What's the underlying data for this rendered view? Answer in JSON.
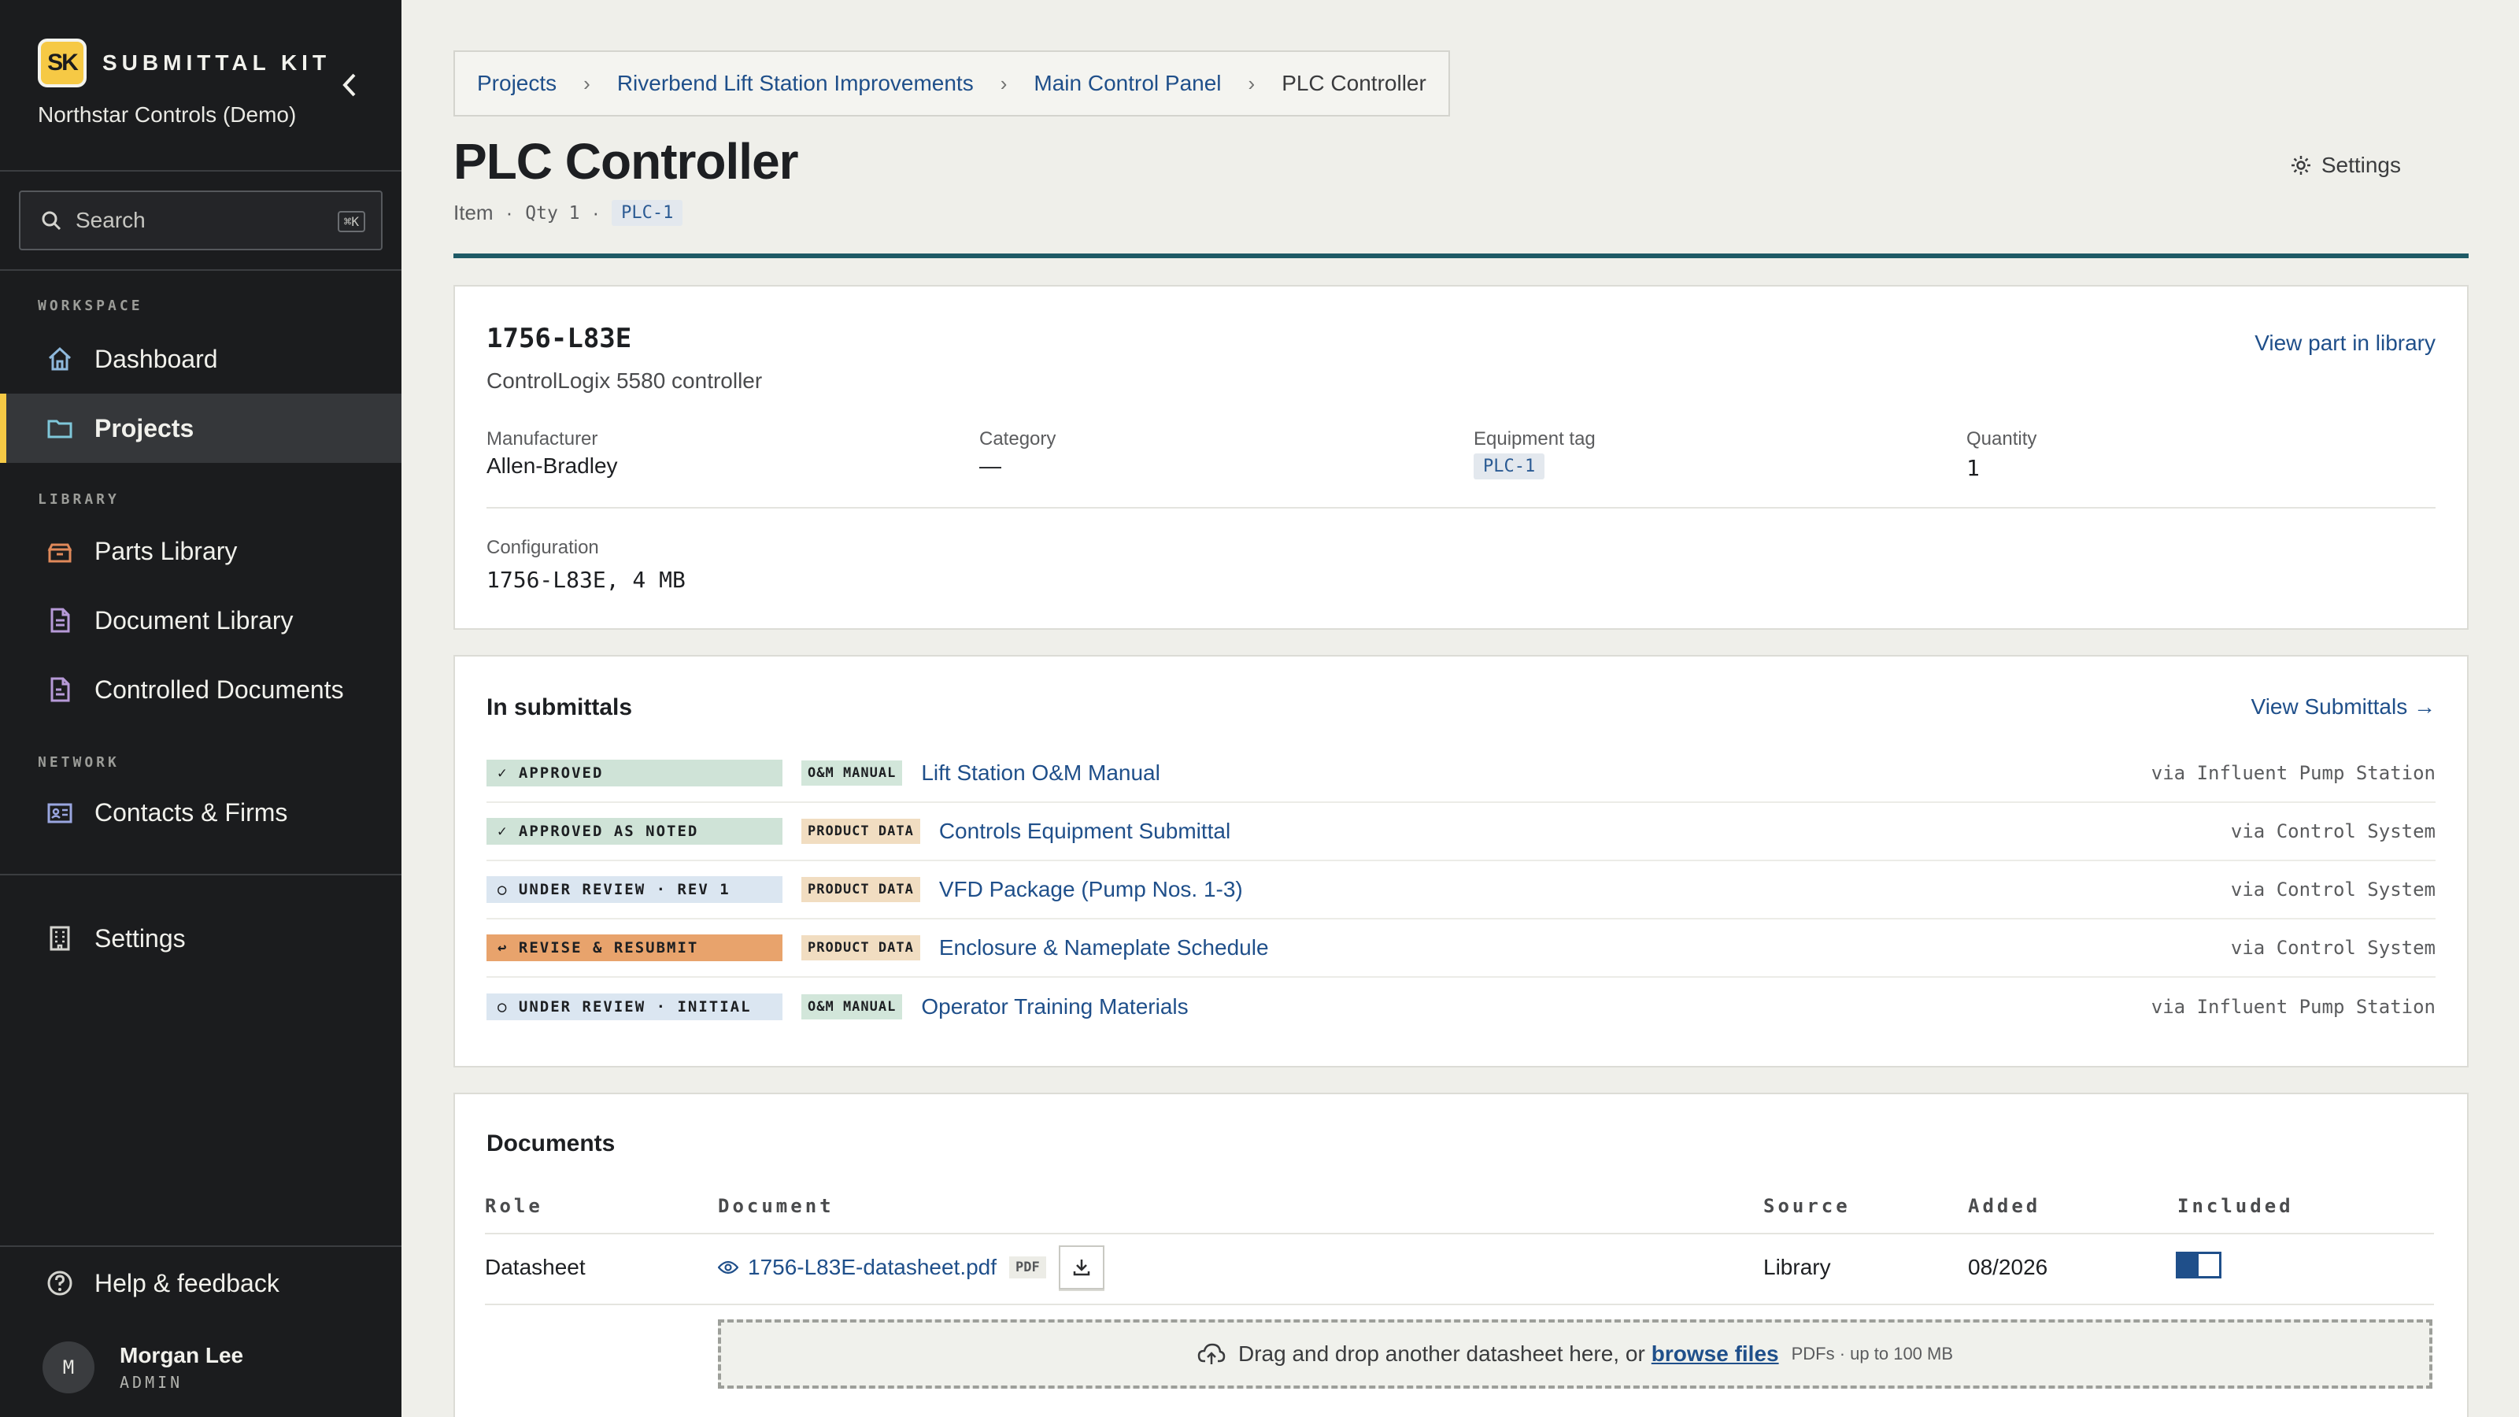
{
  "sidebar": {
    "logo_text": "SK",
    "brand": "SUBMITTAL KIT",
    "org": "Northstar Controls (Demo)",
    "search": {
      "label": "Search",
      "shortcut": "⌘K"
    },
    "sections": {
      "workspace": "WORKSPACE",
      "library": "LIBRARY",
      "network": "NETWORK"
    },
    "items": {
      "dashboard": "Dashboard",
      "projects": "Projects",
      "parts_library": "Parts Library",
      "document_library": "Document Library",
      "controlled_documents": "Controlled Documents",
      "contacts_firms": "Contacts & Firms",
      "settings": "Settings",
      "help": "Help & feedback"
    },
    "active_item": "projects",
    "user": {
      "initial": "M",
      "name": "Morgan Lee",
      "role": "ADMIN"
    }
  },
  "breadcrumb": {
    "items": [
      "Projects",
      "Riverbend Lift Station Improvements",
      "Main Control Panel",
      "PLC Controller"
    ],
    "separator": "›"
  },
  "header": {
    "title": "PLC Controller",
    "type": "Item",
    "qty": "Qty 1",
    "tag": "PLC-1",
    "settings_label": "Settings"
  },
  "part": {
    "number": "1756-L83E",
    "description": "ControlLogix 5580 controller",
    "view_link": "View part in library",
    "fields": {
      "manufacturer": {
        "label": "Manufacturer",
        "value": "Allen-Bradley"
      },
      "category": {
        "label": "Category",
        "value": "—"
      },
      "equipment_tag": {
        "label": "Equipment tag",
        "value": "PLC-1"
      },
      "quantity": {
        "label": "Quantity",
        "value": "1"
      }
    },
    "configuration": {
      "label": "Configuration",
      "value": "1756-L83E, 4 MB"
    }
  },
  "submittals": {
    "title": "In submittals",
    "link": "View Submittals →",
    "rows": [
      {
        "status": "✓ APPROVED",
        "type": "O&M MANUAL",
        "name": "Lift Station O&M Manual",
        "via": "via Influent Pump Station"
      },
      {
        "status": "✓ APPROVED AS NOTED",
        "type": "PRODUCT DATA",
        "name": "Controls Equipment Submittal",
        "via": "via Control System"
      },
      {
        "status": "○ UNDER REVIEW · REV 1",
        "type": "PRODUCT DATA",
        "name": "VFD Package (Pump Nos. 1-3)",
        "via": "via Control System"
      },
      {
        "status": "↩ REVISE & RESUBMIT",
        "type": "PRODUCT DATA",
        "name": "Enclosure & Nameplate Schedule",
        "via": "via Control System"
      },
      {
        "status": "○ UNDER REVIEW · INITIAL",
        "type": "O&M MANUAL",
        "name": "Operator Training Materials",
        "via": "via Influent Pump Station"
      }
    ],
    "colors": {
      "approved": "#cfe3d7",
      "approved_as_noted": "#cfe3d7",
      "under_review": "#dbe6f1",
      "revise": "#e8a36c",
      "om_manual": "#d2e6da",
      "product_data": "#f1ddc1"
    }
  },
  "documents": {
    "title": "Documents",
    "columns": {
      "role": "Role",
      "document": "Document",
      "source": "Source",
      "added": "Added",
      "included": "Included"
    },
    "rows": [
      {
        "role": "Datasheet",
        "file": "1756-L83E-datasheet.pdf",
        "file_type": "PDF",
        "source": "Library",
        "added": "08/2026",
        "included": true
      }
    ],
    "dropzone": {
      "text": "Drag and drop another datasheet here, or",
      "link": "browse files",
      "hint": "PDFs · up to 100 MB"
    }
  }
}
